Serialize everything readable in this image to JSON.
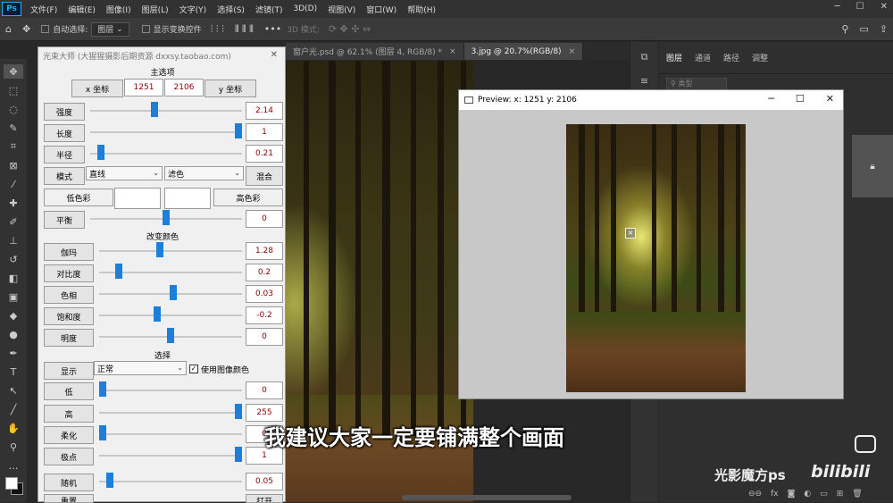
{
  "menubar": {
    "logo": "Ps",
    "items": [
      "文件(F)",
      "编辑(E)",
      "图像(I)",
      "图层(L)",
      "文字(Y)",
      "选择(S)",
      "滤镜(T)",
      "3D(D)",
      "视图(V)",
      "窗口(W)",
      "帮助(H)"
    ]
  },
  "optionsbar": {
    "auto_select": "自动选择:",
    "layer_select": "图层",
    "show_transform": "显示变换控件",
    "mode_3d": "3D 模式:"
  },
  "tabs": [
    {
      "label": "窗户光.psd @ 62.1% (图层 4, RGB/8) *"
    },
    {
      "label": "3.jpg @ 20.7%(RGB/8)"
    }
  ],
  "layers_panel": {
    "tabs": [
      "图层",
      "通道",
      "路径",
      "调整"
    ],
    "kind": "类型"
  },
  "plugin": {
    "title": "光束大师 (大猩猩摄影后期资源 dxxsy.taobao.com)",
    "main_options": "主选项",
    "x_label": "x 坐标",
    "x_value": "1251",
    "y_value": "2106",
    "y_label": "y 坐标",
    "strength_label": "强度",
    "strength_value": "2.14",
    "strength_level": 0.42,
    "length_label": "长度",
    "length_value": "1",
    "length_level": 1.0,
    "radius_label": "半径",
    "radius_value": "0.21",
    "radius_level": 0.05,
    "mode_label": "模式",
    "mode_value": "直线",
    "blend_value": "滤色",
    "mix_label": "混合",
    "low_color_label": "低色彩",
    "high_color_label": "高色彩",
    "balance_label": "平衡",
    "balance_value": "0",
    "balance_level": 0.5,
    "change_color": "改变颜色",
    "gamma_label": "伽玛",
    "gamma_value": "1.28",
    "gamma_level": 0.42,
    "contrast_label": "对比度",
    "contrast_value": "0.2",
    "contrast_level": 0.12,
    "hue_label": "色相",
    "hue_value": "0.03",
    "hue_level": 0.52,
    "saturation_label": "饱和度",
    "saturation_value": "-0.2",
    "saturation_level": 0.4,
    "brightness_label": "明度",
    "brightness_value": "0",
    "brightness_level": 0.5,
    "select_section": "选择",
    "display_label": "显示",
    "display_value": "正常",
    "use_image_color": "使用图像颜色",
    "low_label": "低",
    "low_value": "0",
    "low_level": 0.0,
    "high_label": "高",
    "high_value": "255",
    "high_level": 1.0,
    "soften_label": "柔化",
    "soften_value": "0",
    "soften_level": 0.0,
    "pole_label": "极点",
    "pole_value": "1",
    "pole_level": 1.0,
    "random_label": "随机",
    "random_value": "0.05",
    "random_level": 0.05,
    "reset_label": "重置",
    "open_label": "打开"
  },
  "preview": {
    "title": "Preview:  x: 1251 y: 2106"
  },
  "subtitle": "我建议大家一定要铺满整个画面",
  "watermark": {
    "text": "光影魔方ps",
    "brand": "bilibili"
  }
}
